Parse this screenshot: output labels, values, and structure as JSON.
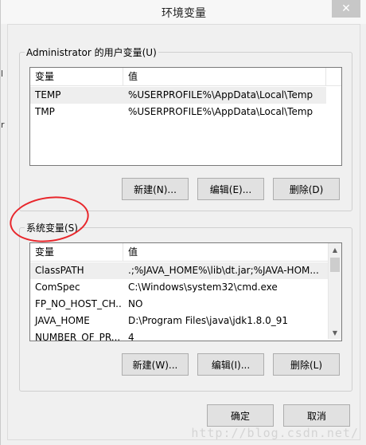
{
  "window": {
    "title": "环境变量",
    "close_glyph": "✕"
  },
  "user_vars": {
    "label": "Administrator 的用户变量(U)",
    "columns": [
      "变量",
      "值"
    ],
    "rows": [
      {
        "name": "TEMP",
        "value": "%USERPROFILE%\\AppData\\Local\\Temp"
      },
      {
        "name": "TMP",
        "value": "%USERPROFILE%\\AppData\\Local\\Temp"
      }
    ],
    "buttons": {
      "new": "新建(N)...",
      "edit": "编辑(E)...",
      "delete": "删除(D)"
    }
  },
  "system_vars": {
    "label": "系统变量(S)",
    "columns": [
      "变量",
      "值"
    ],
    "rows": [
      {
        "name": "ClassPATH",
        "value": ".;%JAVA_HOME%\\lib\\dt.jar;%JAVA-HOM..."
      },
      {
        "name": "ComSpec",
        "value": "C:\\Windows\\system32\\cmd.exe"
      },
      {
        "name": "FP_NO_HOST_CH...",
        "value": "NO"
      },
      {
        "name": "JAVA_HOME",
        "value": "D:\\Program Files\\java\\jdk1.8.0_91"
      },
      {
        "name": "NUMBER_OF_PR...",
        "value": "4"
      }
    ],
    "buttons": {
      "new": "新建(W)...",
      "edit": "编辑(I)...",
      "delete": "删除(L)"
    }
  },
  "footer": {
    "ok": "确定",
    "cancel": "取消"
  },
  "watermark": "http://blog.csdn.net/",
  "colors": {
    "annotation": "#e8262b"
  }
}
